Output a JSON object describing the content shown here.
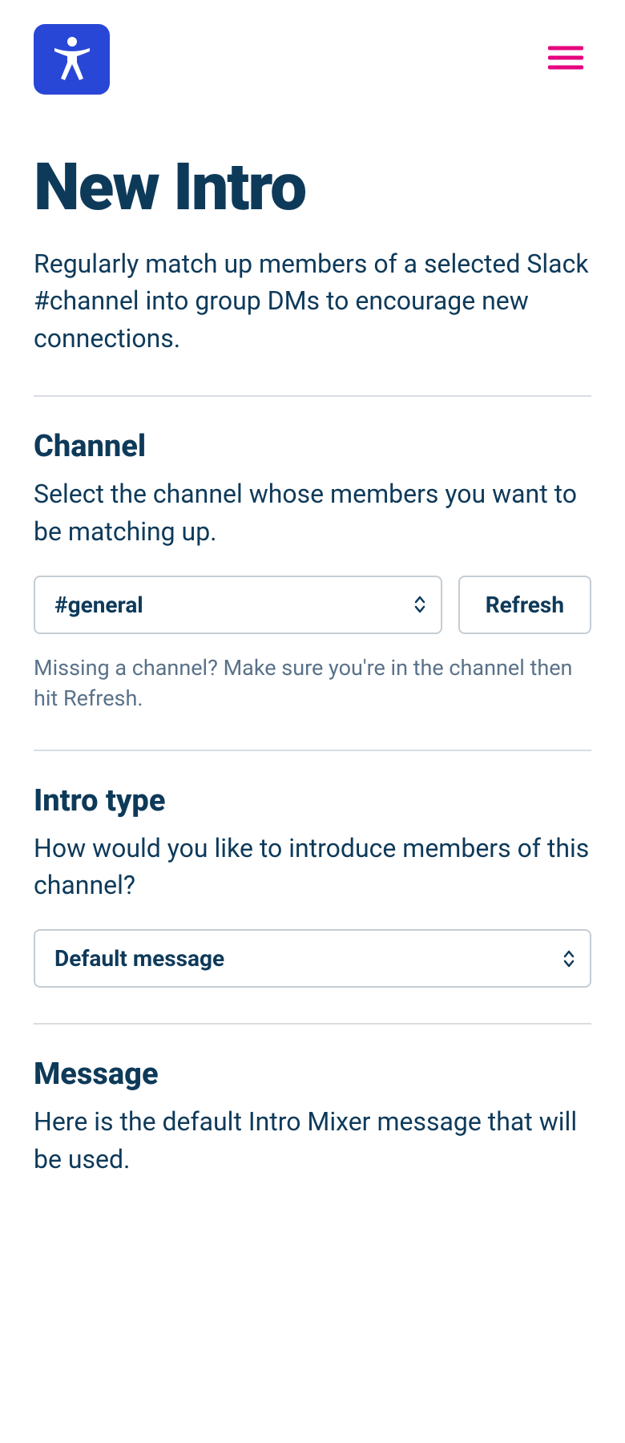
{
  "header": {
    "logo_name": "accessibility-logo"
  },
  "page": {
    "title": "New Intro",
    "description": "Regularly match up members of a selected Slack #channel into group DMs to encourage new connections."
  },
  "channel_section": {
    "title": "Channel",
    "description": "Select the channel whose members you want to be matching up.",
    "selected_value": "#general",
    "refresh_label": "Refresh",
    "hint": "Missing a channel? Make sure you're in the channel then hit Refresh."
  },
  "intro_type_section": {
    "title": "Intro type",
    "description": "How would you like to introduce members of this channel?",
    "selected_value": "Default message"
  },
  "message_section": {
    "title": "Message",
    "description": "Here is the default Intro Mixer message that will be used."
  }
}
